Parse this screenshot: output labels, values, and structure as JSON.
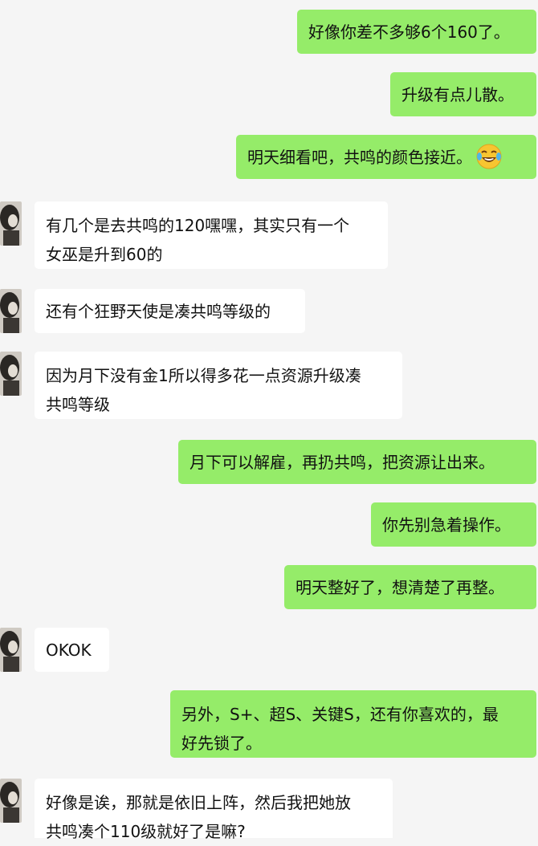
{
  "chat": {
    "messages": [
      {
        "side": "sent",
        "lines": [
          "好像你差不多够6个160了。"
        ]
      },
      {
        "side": "sent",
        "lines": [
          "升级有点儿散。"
        ]
      },
      {
        "side": "sent",
        "lines": [
          "明天细看吧，共鸣的颜色接近。"
        ],
        "emoji": "laughing-tears-emoji"
      },
      {
        "side": "recv",
        "lines": [
          "有几个是去共鸣的120嘿嘿，其实只有一个",
          "女巫是升到60的"
        ]
      },
      {
        "side": "recv",
        "lines": [
          "还有个狂野天使是凑共鸣等级的"
        ]
      },
      {
        "side": "recv",
        "lines": [
          "因为月下没有金1所以得多花一点资源升级凑",
          "共鸣等级"
        ]
      },
      {
        "side": "sent",
        "lines": [
          "月下可以解雇，再扔共鸣，把资源让出来。"
        ]
      },
      {
        "side": "sent",
        "lines": [
          "你先别急着操作。"
        ]
      },
      {
        "side": "sent",
        "lines": [
          "明天整好了，想清楚了再整。"
        ]
      },
      {
        "side": "recv",
        "lines": [
          "OKOK"
        ]
      },
      {
        "side": "sent",
        "lines": [
          "另外，S+、超S、关键S，还有你喜欢的，最",
          "好先锁了。"
        ]
      },
      {
        "side": "recv",
        "lines": [
          "好像是诶，那就是依旧上阵，然后我把她放",
          "共鸣凑个110级就好了是嘛?"
        ]
      }
    ]
  },
  "colors": {
    "sent_bubble": "#95ec69",
    "recv_bubble": "#ffffff",
    "background": "#f5f5f5"
  }
}
